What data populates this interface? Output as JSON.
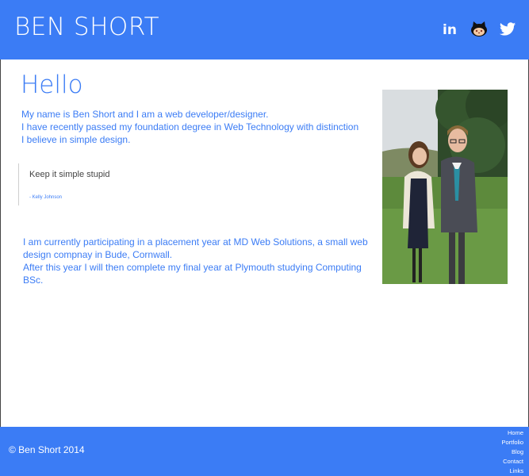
{
  "header": {
    "title": "BEN SHORT",
    "social": [
      {
        "icon": "linkedin-icon",
        "label": "in"
      },
      {
        "icon": "github-icon"
      },
      {
        "icon": "twitter-icon"
      }
    ]
  },
  "main": {
    "heading": "Hello",
    "intro_lines": [
      "My name is Ben Short and I am a web developer/designer.",
      "I have recently passed my foundation degree in Web Technology with distinction",
      "I believe in simple design."
    ],
    "quote": {
      "text": "Keep it simple stupid",
      "author": "- Kelly Johnson"
    },
    "placement": {
      "before_link": "I am currently participating in a placement year at ",
      "link": "MD Web Solutions",
      "after_link": ", a small web design compnay in Bude, Cornwall.",
      "line2": "After this year I will then complete my final year at Plymouth studying Computing BSc."
    }
  },
  "footer": {
    "copyright": "© Ben Short 2014",
    "nav": [
      "Home",
      "Portfolio",
      "Blog",
      "Contact",
      "Links"
    ]
  },
  "colors": {
    "brand": "#3b7cf5",
    "text": "#444444",
    "background": "#ffffff"
  }
}
